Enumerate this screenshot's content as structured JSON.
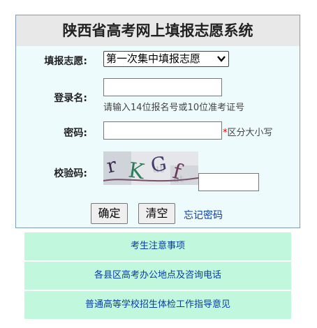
{
  "header": {
    "title": "陕西省高考网上填报志愿系统"
  },
  "form": {
    "session_label": "填报志愿:",
    "session_selected": "第一次集中填报志愿",
    "login_label": "登录名:",
    "login_hint": "请输入14位报名号或10位准考证号",
    "password_label": "密码:",
    "password_star": "*",
    "password_hint": "区分大小写",
    "captcha_label": "校验码:",
    "captcha_text": "rKGf",
    "submit_label": "确定",
    "clear_label": "清空",
    "forgot_label": "忘记密码"
  },
  "links": [
    {
      "label": "考生注意事项"
    },
    {
      "label": "各县区高考办公地点及咨询电话"
    },
    {
      "label": "普通高等学校招生体检工作指导意见"
    }
  ],
  "colors": {
    "link": "#0a3ca3",
    "link_bg": "#c0f7dd",
    "panel_bg": "#eefbfd",
    "title_bg": "#e8e8e8"
  }
}
